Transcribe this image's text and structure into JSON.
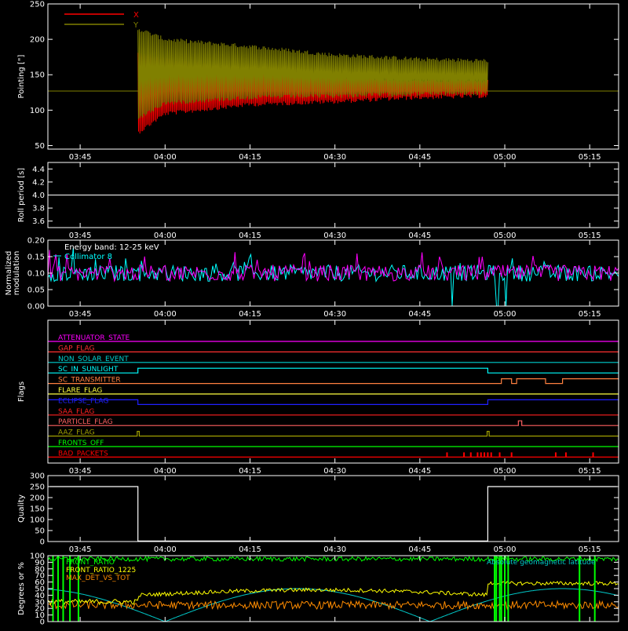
{
  "chart_data": [
    {
      "type": "line",
      "ylabel": "Pointing [\"]",
      "ylim": [
        45,
        250
      ],
      "yticks": [
        "50",
        "100",
        "150",
        "200",
        "250"
      ],
      "xticks": [
        "03:45",
        "04:00",
        "04:15",
        "04:30",
        "04:45",
        "05:00",
        "05:15"
      ],
      "legend": "top-left",
      "series": [
        {
          "name": "X",
          "color": "#ff0000",
          "upper_envelope": [
            [
              3.92,
              180
            ],
            [
              4.0,
              172
            ],
            [
              4.25,
              158
            ],
            [
              4.5,
              148
            ],
            [
              4.75,
              142
            ],
            [
              4.95,
              142
            ]
          ],
          "lower_envelope": [
            [
              3.92,
              68
            ],
            [
              4.0,
              95
            ],
            [
              4.25,
              108
            ],
            [
              4.5,
              112
            ],
            [
              4.75,
              118
            ],
            [
              4.95,
              120
            ]
          ]
        },
        {
          "name": "Y",
          "color": "#808000",
          "upper_envelope": [
            [
              3.92,
              215
            ],
            [
              4.0,
              200
            ],
            [
              4.25,
              190
            ],
            [
              4.5,
              178
            ],
            [
              4.75,
              172
            ],
            [
              4.95,
              170
            ]
          ],
          "lower_envelope": [
            [
              3.92,
              88
            ],
            [
              4.0,
              110
            ],
            [
              4.25,
              118
            ],
            [
              4.5,
              120
            ],
            [
              4.75,
              123
            ],
            [
              4.95,
              124
            ]
          ],
          "baseline": 127
        }
      ]
    },
    {
      "type": "line",
      "ylabel": "Roll period [s]",
      "ylim": [
        3.5,
        4.5
      ],
      "yticks": [
        "3.6",
        "3.8",
        "4.0",
        "4.2",
        "4.4"
      ],
      "xticks": [
        "03:45",
        "04:00",
        "04:15",
        "04:30",
        "04:45",
        "05:00",
        "05:15"
      ],
      "series": [
        {
          "name": "",
          "color": "#ffffff",
          "constant": 4.0
        }
      ]
    },
    {
      "type": "line",
      "ylabel": "Normalized modulation",
      "ylim": [
        0.0,
        0.2
      ],
      "yticks": [
        "0.00",
        "0.05",
        "0.10",
        "0.15",
        "0.20"
      ],
      "xticks": [
        "03:45",
        "04:00",
        "04:15",
        "04:30",
        "04:45",
        "05:00",
        "05:15"
      ],
      "legend_text": [
        "Energy band: 12-25 keV",
        "Collimator 8"
      ],
      "series": [
        {
          "name": "Energy band: 12-25 keV",
          "color": "#ffffff"
        },
        {
          "name": "Collimator 8",
          "color": "#00ffff",
          "mean": 0.1
        },
        {
          "name": "",
          "color": "#ff00ff",
          "mean": 0.1
        }
      ]
    },
    {
      "type": "flags",
      "ylabel": "Flags",
      "xticks": [
        "03:45",
        "04:00",
        "04:15",
        "04:30",
        "04:45",
        "05:00",
        "05:15"
      ],
      "flags": [
        {
          "label": "ATTENUATOR_STATE",
          "color": "#ff00ff"
        },
        {
          "label": "GAP_FLAG",
          "color": "#ff3030"
        },
        {
          "label": "NON_SOLAR_EVENT",
          "color": "#00d0d0"
        },
        {
          "label": "SC_IN_SUNLIGHT",
          "color": "#00ffff"
        },
        {
          "label": "SC_TRANSMITTER",
          "color": "#ff8040"
        },
        {
          "label": "FLARE_FLAG",
          "color": "#ffff40"
        },
        {
          "label": "ECLIPSE_FLAG",
          "color": "#2020ff"
        },
        {
          "label": "SAA_FLAG",
          "color": "#ff2020"
        },
        {
          "label": "PARTICLE_FLAG",
          "color": "#ff6060"
        },
        {
          "label": "AAZ_FLAG",
          "color": "#a0a000"
        },
        {
          "label": "FRONTS_OFF",
          "color": "#00ff00"
        },
        {
          "label": "BAD_PACKETS",
          "color": "#ff0000"
        }
      ]
    },
    {
      "type": "line",
      "ylabel": "Quality",
      "ylim": [
        0,
        300
      ],
      "yticks": [
        "0",
        "50",
        "100",
        "150",
        "200",
        "250",
        "300"
      ],
      "xticks": [
        "03:45",
        "04:00",
        "04:15",
        "04:30",
        "04:45",
        "05:00",
        "05:15"
      ],
      "series": [
        {
          "name": "",
          "color": "#ffffff",
          "points": [
            [
              3.66,
              250
            ],
            [
              3.92,
              250
            ],
            [
              3.92,
              2
            ],
            [
              4.95,
              2
            ],
            [
              4.95,
              250
            ],
            [
              5.33,
              250
            ]
          ]
        }
      ]
    },
    {
      "type": "line",
      "ylabel": "Degrees or %",
      "ylim": [
        0,
        100
      ],
      "yticks": [
        "0",
        "10",
        "20",
        "30",
        "40",
        "50",
        "60",
        "70",
        "80",
        "90",
        "100"
      ],
      "legend_text": [
        "FRONT_RATIO",
        "FRONT_RATIO_1225",
        "MAX_DET_VS_TOT",
        "Absolute geomagnetic latitude"
      ],
      "series": [
        {
          "name": "FRONT_RATIO",
          "color": "#00ff00",
          "mean": 96
        },
        {
          "name": "FRONT_RATIO_1225",
          "color": "#ffff00",
          "mean": 45
        },
        {
          "name": "MAX_DET_VS_TOT",
          "color": "#ff8c00",
          "mean": 25
        },
        {
          "name": "Absolute geomagnetic latitude",
          "color": "#00c8c8"
        }
      ]
    }
  ]
}
